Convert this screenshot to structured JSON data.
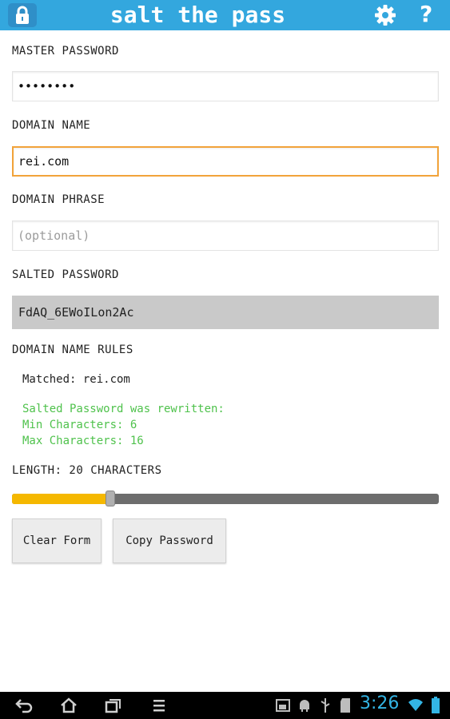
{
  "app": {
    "title": "salt the pass",
    "icons": {
      "lock": "lock-icon",
      "settings": "gear-icon",
      "help": "help-icon"
    },
    "accent_color": "#33a7de"
  },
  "form": {
    "master_password": {
      "label": "MASTER PASSWORD",
      "value": "••••••••"
    },
    "domain_name": {
      "label": "DOMAIN NAME",
      "value": "rei.com"
    },
    "domain_phrase": {
      "label": "DOMAIN PHRASE",
      "placeholder": "(optional)"
    },
    "salted_password": {
      "label": "SALTED PASSWORD",
      "value": "FdAQ_6EWoILon2Ac"
    },
    "rules": {
      "label": "DOMAIN NAME RULES",
      "matched": "Matched: rei.com",
      "rewritten": "Salted Password was rewritten:",
      "min_chars": "Min Characters: 6",
      "max_chars": "Max Characters: 16",
      "rule_color": "#4fc24c"
    },
    "length": {
      "label": "LENGTH: 20 CHARACTERS",
      "fraction": 0.23
    },
    "buttons": {
      "clear": "Clear Form",
      "copy": "Copy Password"
    }
  },
  "system_bar": {
    "time": "3:26",
    "nav_icons": [
      "back-icon",
      "home-icon",
      "recent-apps-icon",
      "menu-icon"
    ],
    "status_icons": [
      "screenshot-icon",
      "android-debug-icon",
      "usb-icon",
      "sd-card-icon",
      "wifi-icon",
      "battery-icon"
    ]
  }
}
